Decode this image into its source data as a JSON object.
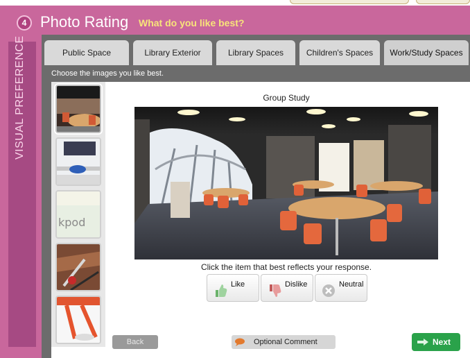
{
  "header": {
    "step_number": "4",
    "title": "Photo Rating",
    "subtitle": "What do you like best?"
  },
  "sidebar": {
    "label": "VISUAL PREFERENCE"
  },
  "tabs": [
    {
      "label": "Public Space"
    },
    {
      "label": "Library Exterior"
    },
    {
      "label": "Library Spaces"
    },
    {
      "label": "Children's Spaces"
    },
    {
      "label": "Work/Study Spaces"
    }
  ],
  "instructions": "Choose the images you like best.",
  "image": {
    "title": "Group Study"
  },
  "thumbnails": [
    {
      "name": "thumb-group-study"
    },
    {
      "name": "thumb-desk"
    },
    {
      "name": "thumb-kpod",
      "text": "kpod"
    },
    {
      "name": "thumb-tools"
    },
    {
      "name": "thumb-red-chair"
    }
  ],
  "prompt": "Click the item that best reflects your response.",
  "choices": {
    "like": "Like",
    "dislike": "Dislike",
    "neutral": "Neutral"
  },
  "footer": {
    "back": "Back",
    "comment": "Optional Comment",
    "next": "Next"
  },
  "colors": {
    "background": "#c9679c",
    "sidebar": "#a64a83",
    "subtitle": "#f8e47a",
    "next_button": "#2aa24a"
  }
}
